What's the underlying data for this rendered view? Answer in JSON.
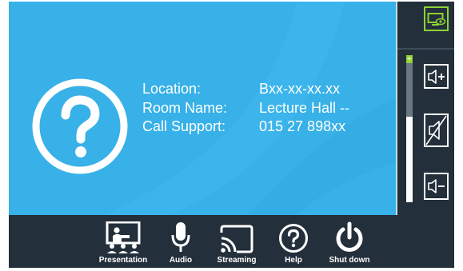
{
  "info": {
    "location_label": "Location:",
    "location_value": "Bxx-xx-xx.xx",
    "room_label": "Room Name:",
    "room_value": "Lecture Hall --",
    "support_label": "Call Support:",
    "support_value": "015 27 898xx"
  },
  "volume": {
    "level": 0.58,
    "plus_marker": "+"
  },
  "nav": {
    "presentation": "Presentation",
    "audio": "Audio",
    "streaming": "Streaming",
    "help": "Help",
    "shutdown": "Shut down"
  },
  "colors": {
    "main_background": "#37b1e8",
    "bar_background": "#232f3a",
    "accent_green": "#8fd134"
  },
  "icons": {
    "main": "help-circle-icon",
    "side": [
      "display-preview-icon",
      "volume-up-icon",
      "mute-icon",
      "volume-down-icon"
    ],
    "bottom": [
      "presentation-icon",
      "microphone-icon",
      "cast-icon",
      "help-icon",
      "power-icon"
    ]
  }
}
